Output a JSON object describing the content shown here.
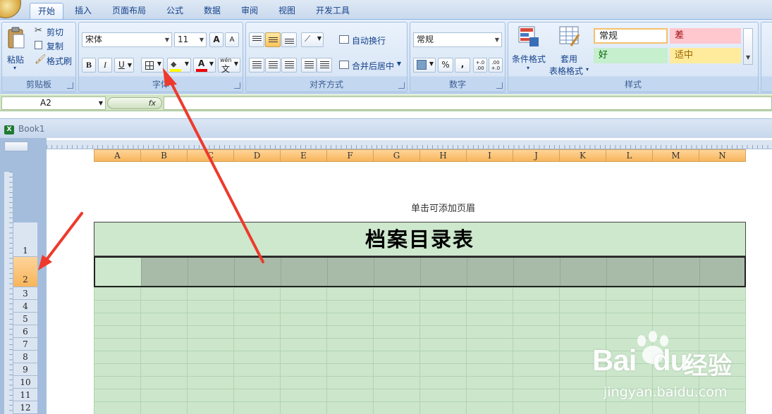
{
  "tabs": [
    {
      "label": "开始"
    },
    {
      "label": "插入"
    },
    {
      "label": "页面布局"
    },
    {
      "label": "公式"
    },
    {
      "label": "数据"
    },
    {
      "label": "审阅"
    },
    {
      "label": "视图"
    },
    {
      "label": "开发工具"
    }
  ],
  "clipboard": {
    "paste": "粘贴",
    "cut": "剪切",
    "copy": "复制",
    "format_painter": "格式刷",
    "label": "剪贴板"
  },
  "font": {
    "name": "宋体",
    "size": "11",
    "bold": "B",
    "italic": "I",
    "underline": "U",
    "grow": "A",
    "shrink": "A",
    "font_color_glyph": "A",
    "phonetic": "wén",
    "phonetic_char": "文",
    "label": "字体"
  },
  "alignment": {
    "wrap": "自动换行",
    "merge": "合并后居中",
    "label": "对齐方式"
  },
  "number": {
    "format": "常规",
    "percent": "%",
    "comma": ",",
    "inc_decimal": "+.0\n.00",
    "dec_decimal": ".00\n+.0",
    "label": "数字"
  },
  "styles": {
    "conditional": "条件格式",
    "table_format_1": "套用",
    "table_format_2": "表格格式",
    "normal": "常规",
    "bad": "差",
    "good": "好",
    "neutral": "适中",
    "label": "样式"
  },
  "formula_bar": {
    "name_box": "A2",
    "fx": "fx"
  },
  "workbook": {
    "title": "Book1"
  },
  "columns": [
    "A",
    "B",
    "C",
    "D",
    "E",
    "F",
    "G",
    "H",
    "I",
    "J",
    "K",
    "L",
    "M",
    "N"
  ],
  "rows": [
    "1",
    "2",
    "3",
    "4",
    "5",
    "6",
    "7",
    "8",
    "9",
    "10",
    "11",
    "12"
  ],
  "sheet": {
    "header_hint": "单击可添加页眉",
    "title_cell": "档案目录表"
  },
  "watermark": {
    "brand": "Bai",
    "brand2": "du",
    "cn": "经验",
    "url": "jingyan.baidu.com"
  },
  "colors": {
    "accent_arrow": "#ee3a2c",
    "selected_header": "#f7b55a",
    "sheet_green": "#cde8cc"
  }
}
